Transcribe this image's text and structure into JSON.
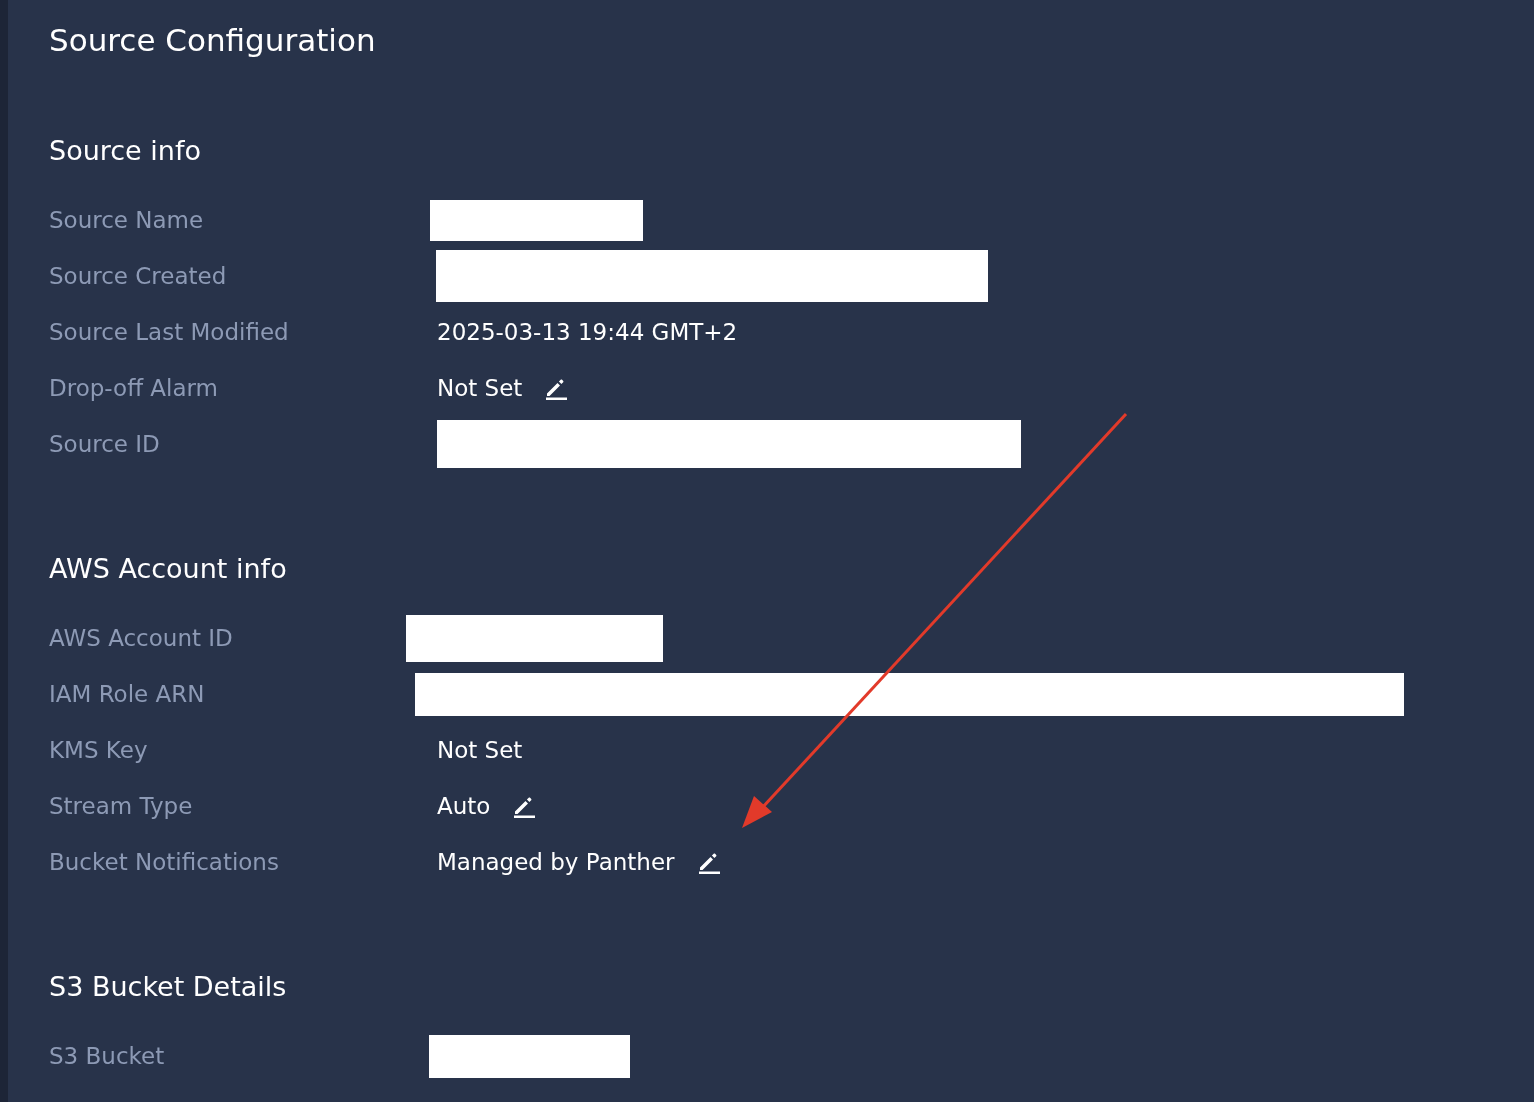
{
  "title": "Source Configuration",
  "sections": [
    {
      "heading": "Source info",
      "rows": [
        {
          "label": "Source Name",
          "kind": "redacted"
        },
        {
          "label": "Source Created",
          "kind": "redacted"
        },
        {
          "label": "Source Last Modified",
          "kind": "text",
          "value": "2025-03-13 19:44 GMT+2",
          "editable": false
        },
        {
          "label": "Drop-off Alarm",
          "kind": "text",
          "value": "Not Set",
          "editable": true
        },
        {
          "label": "Source ID",
          "kind": "redacted"
        }
      ]
    },
    {
      "heading": "AWS Account info",
      "rows": [
        {
          "label": "AWS Account ID",
          "kind": "redacted"
        },
        {
          "label": "IAM Role ARN",
          "kind": "redacted"
        },
        {
          "label": "KMS Key",
          "kind": "text",
          "value": "Not Set",
          "editable": false
        },
        {
          "label": "Stream Type",
          "kind": "text",
          "value": "Auto",
          "editable": true
        },
        {
          "label": "Bucket Notifications",
          "kind": "text",
          "value": "Managed by Panther",
          "editable": true
        }
      ]
    },
    {
      "heading": "S3 Bucket Details",
      "rows": [
        {
          "label": "S3 Bucket",
          "kind": "redacted"
        }
      ]
    }
  ]
}
